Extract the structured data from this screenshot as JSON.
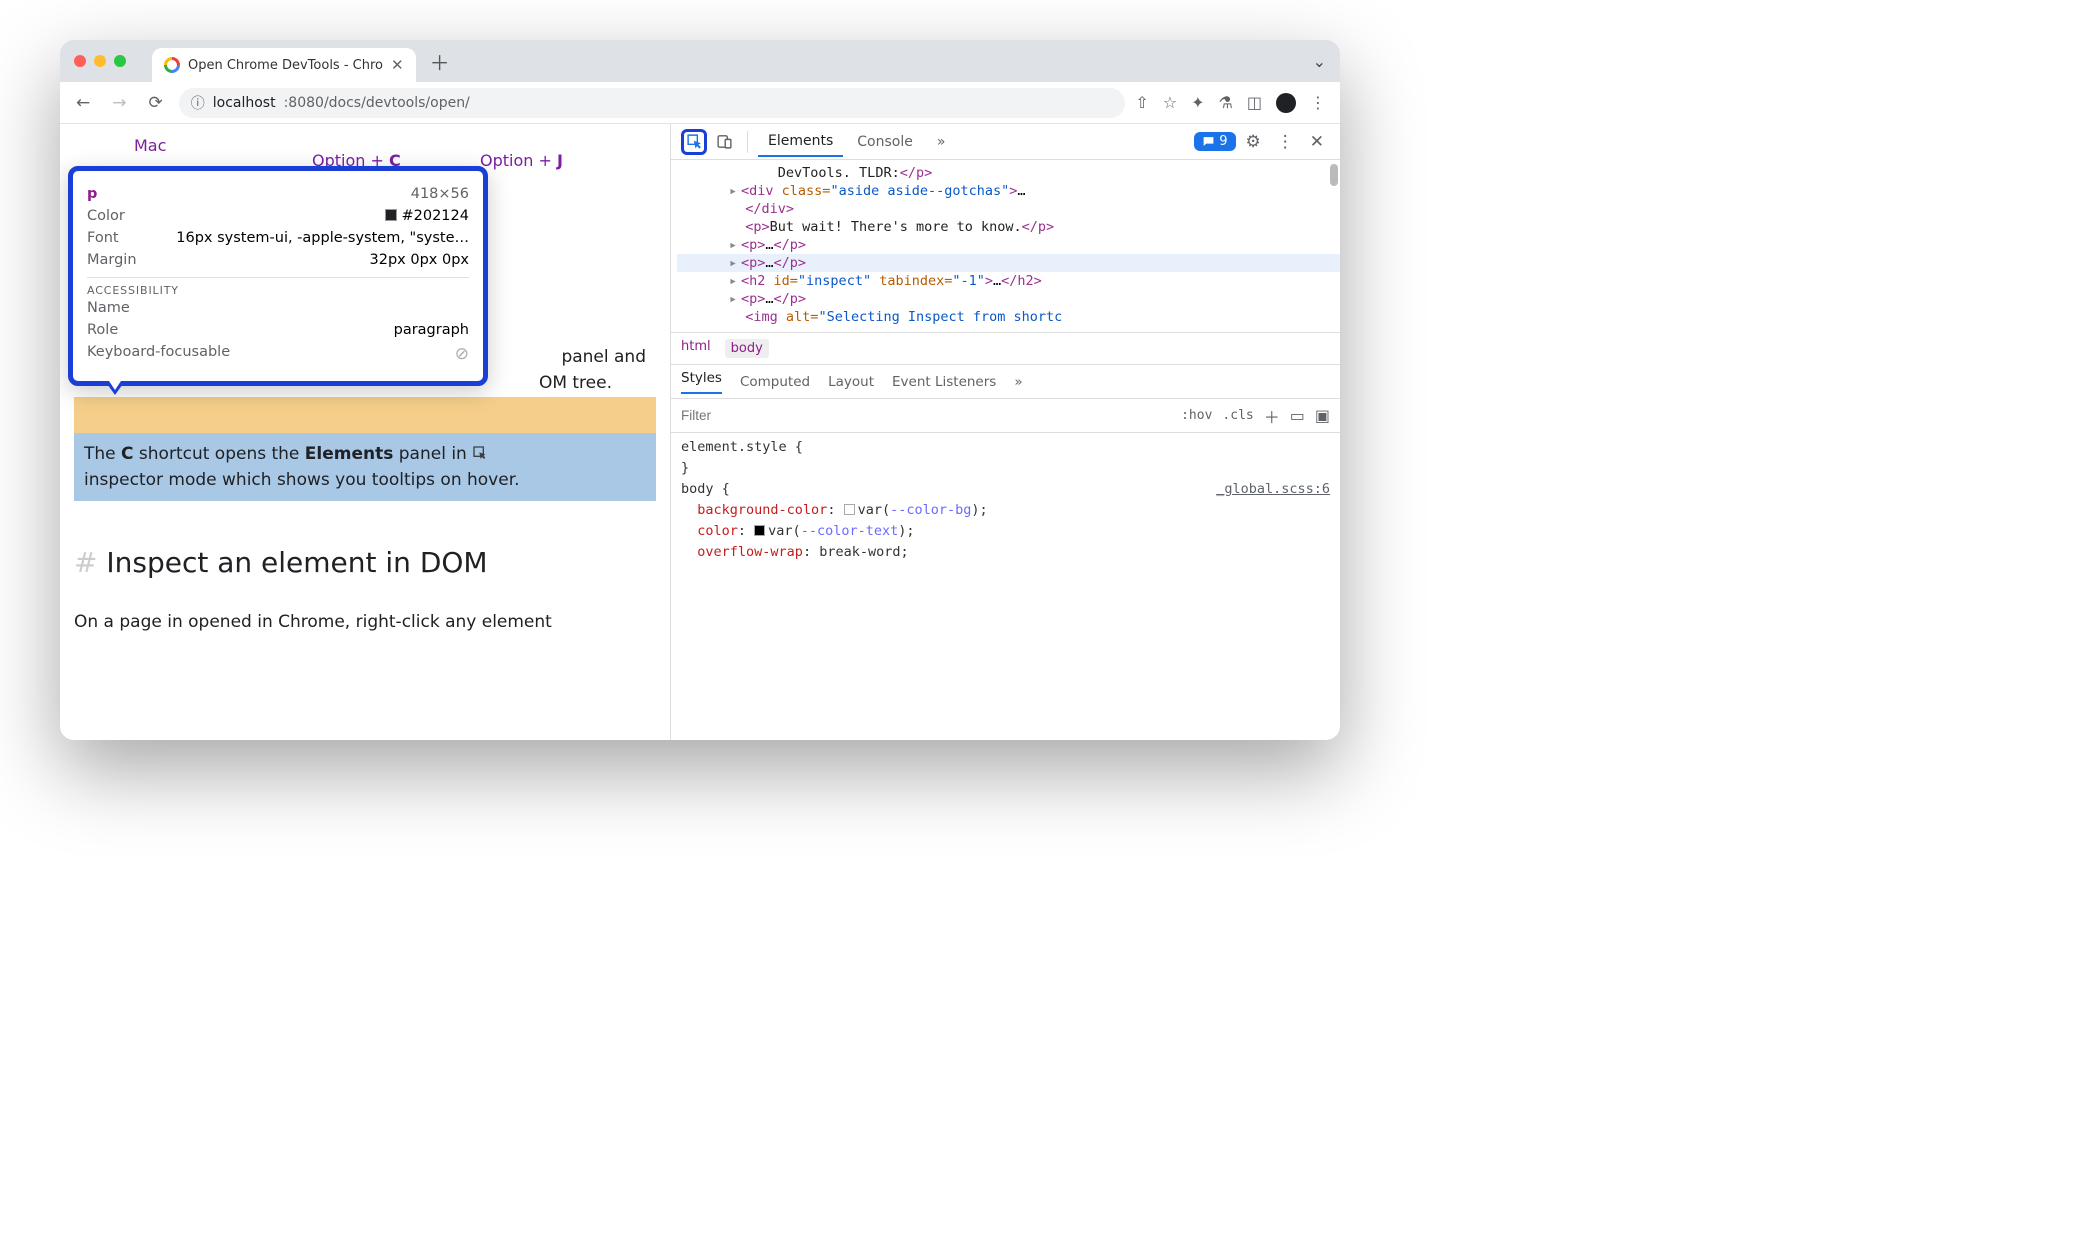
{
  "tab": {
    "title": "Open Chrome DevTools - Chro"
  },
  "omnibox": {
    "host": "localhost",
    "rest": ":8080/docs/devtools/open/"
  },
  "page": {
    "mac": "Mac",
    "shortcut_c": "Option + ",
    "shortcut_c_key": "C",
    "shortcut_j": "Option + ",
    "shortcut_j_key": "J",
    "partial_tail1": " panel and",
    "partial_tail2": "OM tree.",
    "blue_pre": "The ",
    "blue_letter": "C",
    "blue_mid": " shortcut opens the ",
    "blue_el": "Elements",
    "blue_post1": " panel in ",
    "blue_line2": "inspector mode which shows you tooltips on hover.",
    "h2": "Inspect an element in DOM",
    "p": "On a page in opened in Chrome, right-click any element"
  },
  "tooltip": {
    "selector": "p",
    "dims": "418×56",
    "color_label": "Color",
    "color_value": "#202124",
    "font_label": "Font",
    "font_value": "16px system-ui, -apple-system, \"syste…",
    "margin_label": "Margin",
    "margin_value": "32px 0px 0px",
    "a11y_header": "ACCESSIBILITY",
    "name_label": "Name",
    "role_label": "Role",
    "role_value": "paragraph",
    "keyboard_label": "Keyboard-focusable"
  },
  "devtools": {
    "tabs": {
      "elements": "Elements",
      "console": "Console"
    },
    "issues_count": "9",
    "dom": {
      "l0": "DevTools. TLDR:",
      "l1_cls": "\"aside aside--gotchas\"",
      "l2": "But wait! There's more to know.",
      "l3_id": "\"inspect\"",
      "l3_tab": "\"-1\"",
      "l4_alt": "\"Selecting Inspect from shortc"
    },
    "breadcrumb": {
      "html": "html",
      "body": "body"
    },
    "subtabs": {
      "styles": "Styles",
      "computed": "Computed",
      "layout": "Layout",
      "event": "Event Listeners"
    },
    "filter": {
      "placeholder": "Filter",
      "hov": ":hov",
      "cls": ".cls"
    },
    "css": {
      "element_style": "element.style {",
      "brace_close": "}",
      "body_open": "body {",
      "src": "_global.scss:6",
      "bg_prop": "background-color",
      "bg_var": "--color-bg",
      "color_prop": "color",
      "color_var": "--color-text",
      "wrap_prop": "overflow-wrap",
      "wrap_val": "break-word"
    }
  }
}
